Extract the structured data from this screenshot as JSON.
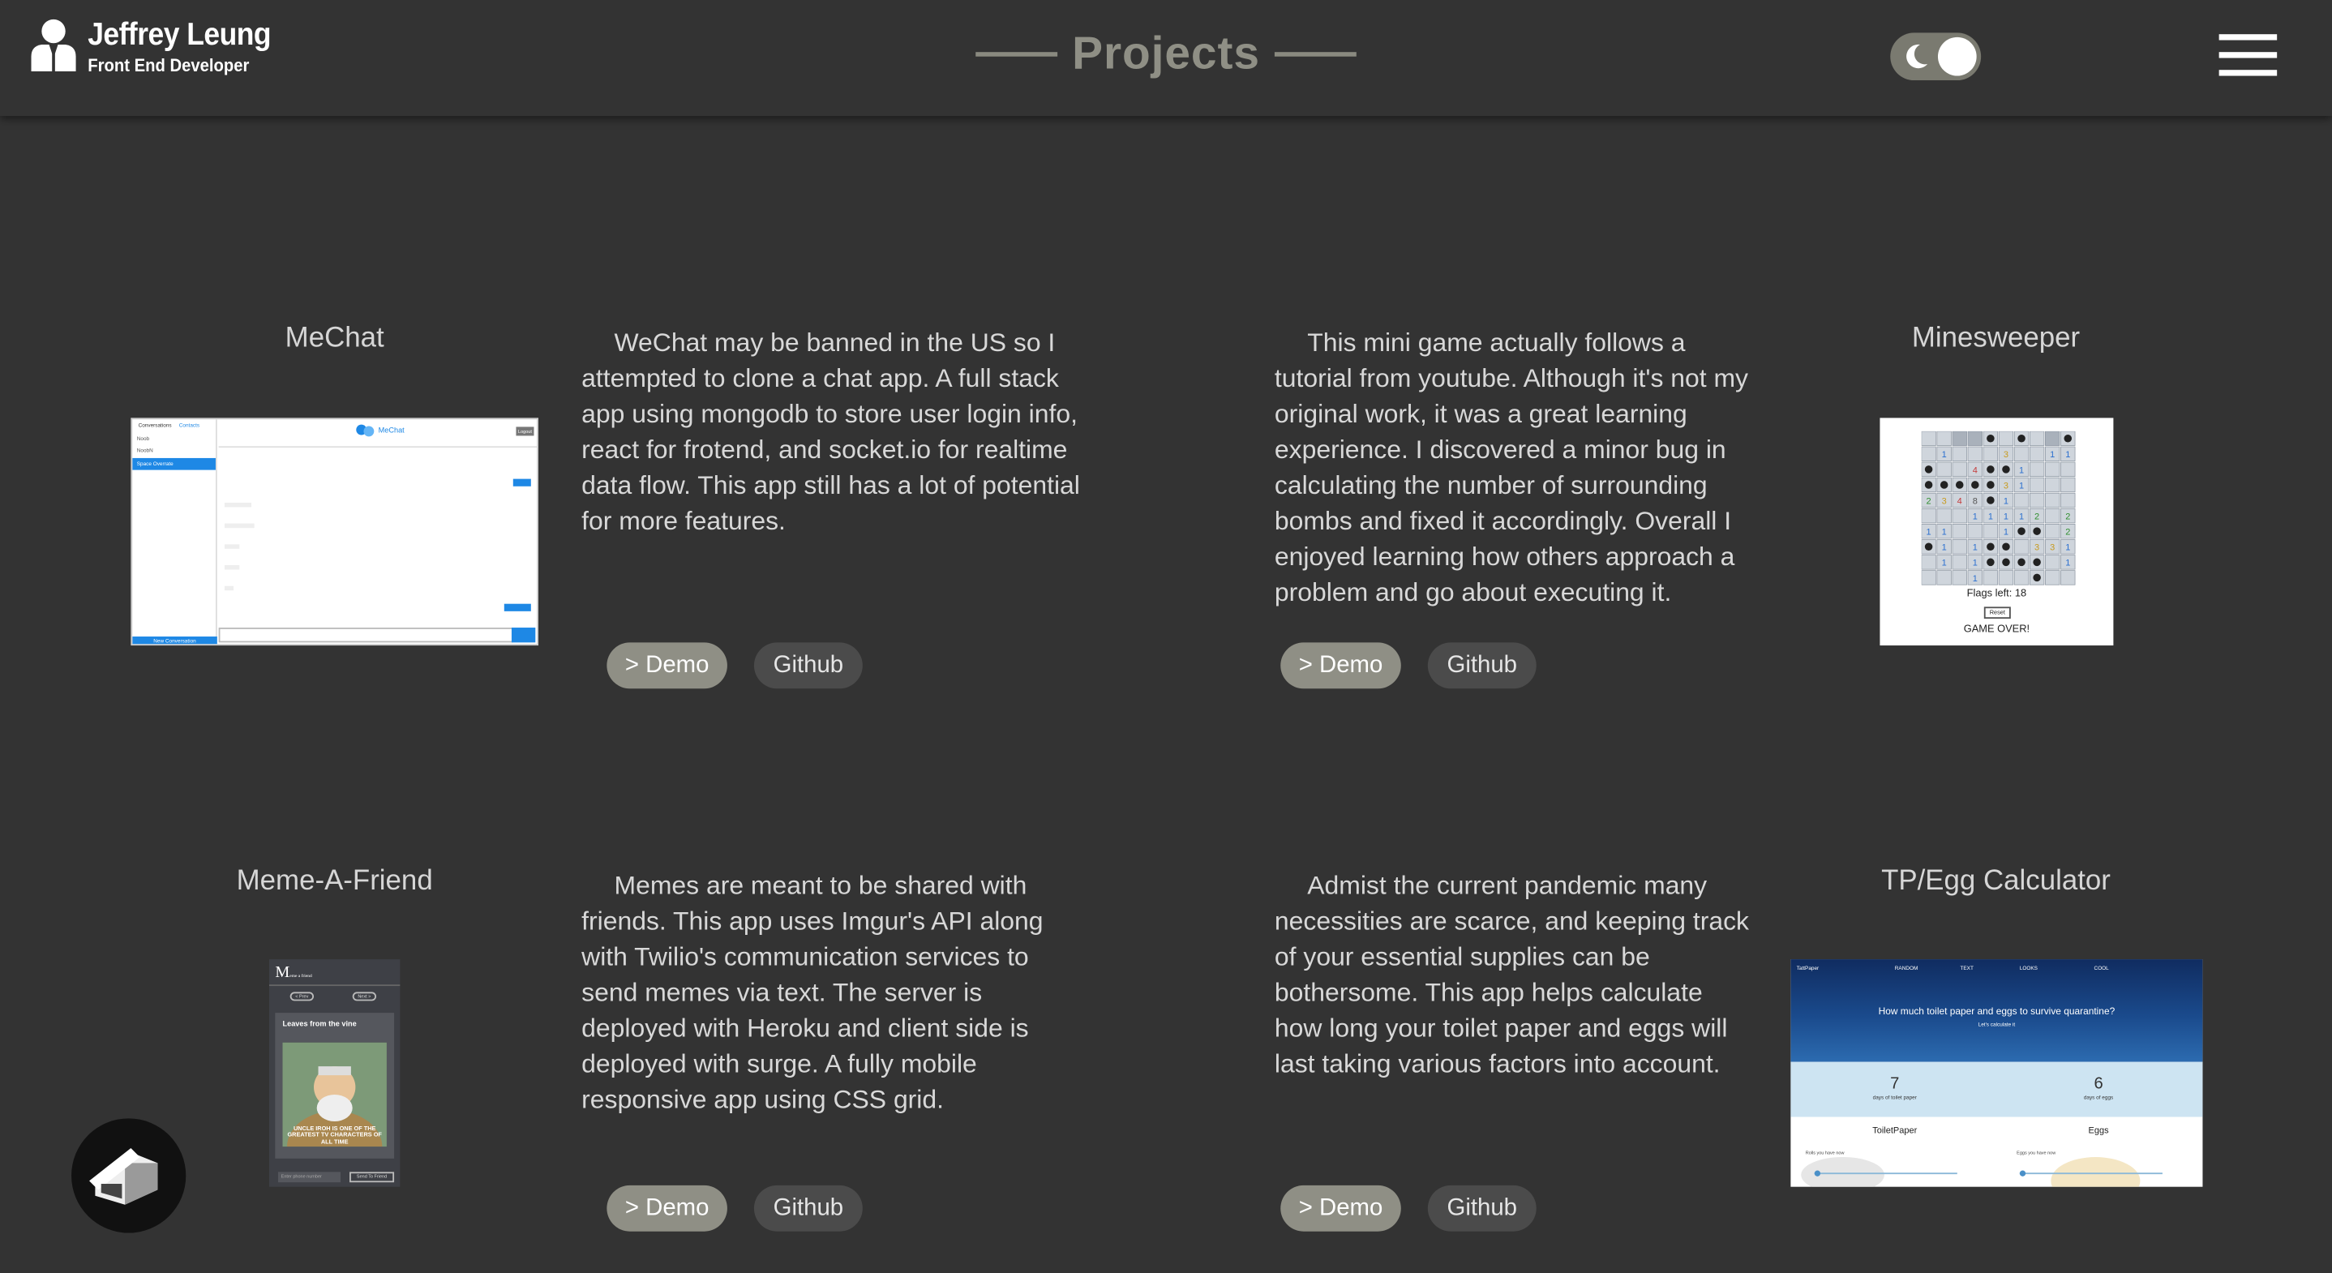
{
  "header": {
    "name": "Jeffrey Leung",
    "role": "Front End Developer",
    "page_title": "Projects",
    "theme_toggle_state": "dark"
  },
  "projects": [
    {
      "title": "MeChat",
      "description": "WeChat may be banned in the US so I attempted to clone a chat app. A full stack app using mongodb to store user login info, react for frotend, and socket.io for realtime data flow. This app still has a lot of potential for more features.",
      "demo_label": "> Demo",
      "github_label": "Github",
      "thumb": {
        "sidebar_top": "Conversations",
        "sidebar_tab": "Contacts",
        "app_name": "MeChat",
        "logout": "Logout",
        "sidebar_items": [
          "Noob",
          "NoobN",
          "Space Overrate"
        ],
        "new_convo": "New Conversation"
      }
    },
    {
      "title": "Minesweeper",
      "description": "This mini game actually follows a tutorial from youtube. Although it's not my original work, it was a great learning experience. I discovered a minor bug in calculating the number of surrounding bombs and fixed it accordingly. Overall I enjoyed learning how others approach a problem and go about executing it.",
      "demo_label": "> Demo",
      "github_label": "Github",
      "thumb": {
        "flags_text": "Flags left: 18",
        "reset_label": "Reset",
        "game_over": "GAME OVER!"
      }
    },
    {
      "title": "Meme-A-Friend",
      "description": "Memes are meant to be shared with friends. This app uses Imgur's API along with Twilio's communication services to send memes via text. The server is deployed with Heroku and client side is deployed with surge. A fully mobile responsive app using CSS grid.",
      "demo_label": "> Demo",
      "github_label": "Github",
      "thumb": {
        "logo_letter": "M",
        "logo_sub": "eme a friend",
        "prev": "< Prev",
        "next": "Next >",
        "meme_title": "Leaves from the vine",
        "meme_caption": "UNCLE IROH IS ONE OF THE GREATEST TV CHARACTERS OF ALL TIME",
        "phone_placeholder": "Enter phone number",
        "send": "Send To Friend"
      }
    },
    {
      "title": "TP/Egg Calculator",
      "description": "Admist the current pandemic many necessities are scarce, and keeping track of your essential supplies can be bothersome. This app helps calculate how long your toilet paper and eggs will last taking various factors into account.",
      "demo_label": "> Demo",
      "github_label": "Github",
      "thumb": {
        "brand": "TattPaper",
        "nav": [
          "RANDOM",
          "TEXT",
          "LOOKS",
          "COOL"
        ],
        "question": "How much toilet paper and eggs to survive quarantine?",
        "sub": "Let's calculate it",
        "tp_days": "7",
        "tp_days_label": "days of toilet paper",
        "egg_days": "6",
        "egg_days_label": "days of eggs",
        "tp_col": "ToiletPaper",
        "egg_col": "Eggs",
        "tp_have": "Rolls you have now",
        "egg_have": "Eggs you have now"
      }
    }
  ]
}
